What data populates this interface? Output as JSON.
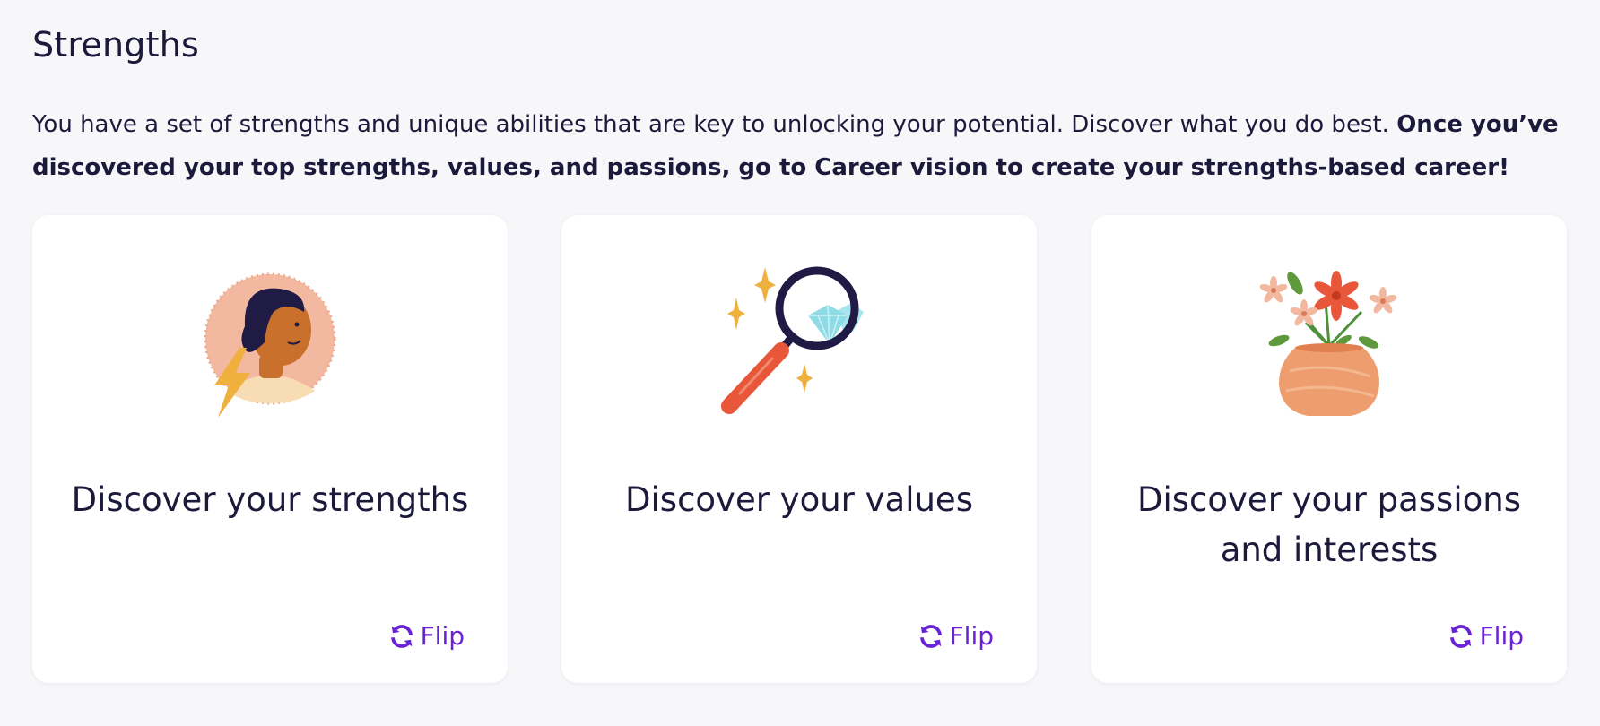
{
  "section": {
    "title": "Strengths",
    "intro_regular": "You have a set of strengths and unique abilities that are key to unlocking your potential. Discover what you do best. ",
    "intro_bold": "Once you’ve discovered your top strengths, values, and passions, go to Career vision to create your strengths-based career!"
  },
  "cards": [
    {
      "title": "Discover your strengths",
      "illustration": "person-lightning-illustration",
      "flip_label": "Flip",
      "flip_icon": "refresh-icon"
    },
    {
      "title": "Discover your values",
      "illustration": "magnifying-glass-diamond-illustration",
      "flip_label": "Flip",
      "flip_icon": "refresh-icon"
    },
    {
      "title": "Discover your passions and interests",
      "illustration": "flower-vase-illustration",
      "flip_label": "Flip",
      "flip_icon": "refresh-icon"
    }
  ],
  "colors": {
    "accent": "#6a22d6",
    "text": "#1c1a3b",
    "background": "#f7f6f9",
    "card": "#ffffff"
  }
}
